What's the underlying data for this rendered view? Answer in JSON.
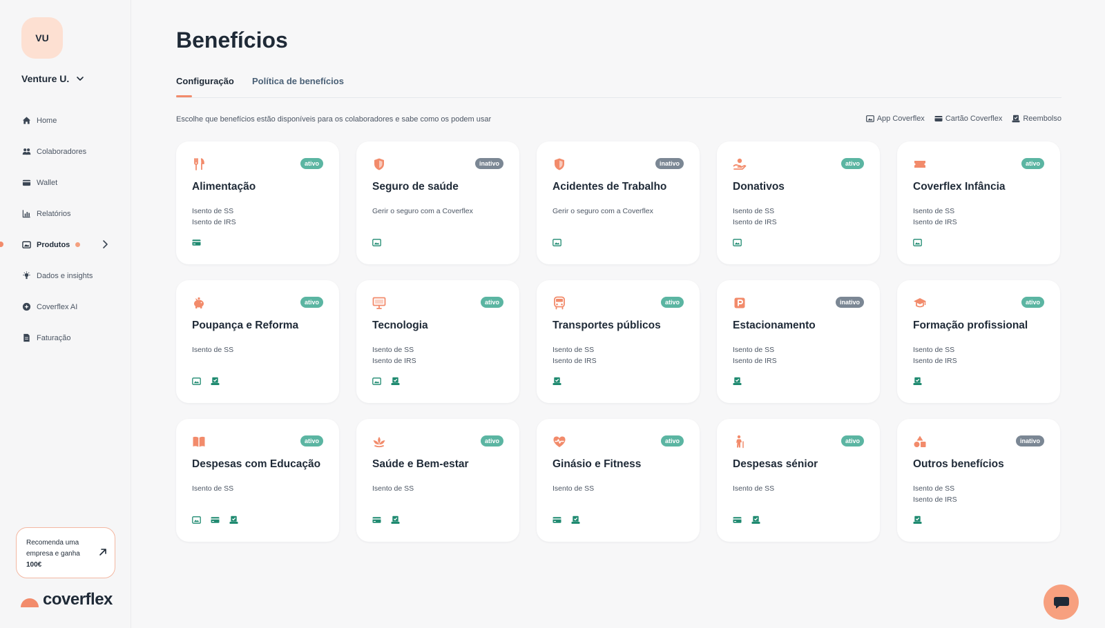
{
  "sidebar": {
    "avatar_initials": "VU",
    "company_name": "Venture U.",
    "items": [
      {
        "label": "Home",
        "icon": "home-icon"
      },
      {
        "label": "Colaboradores",
        "icon": "users-icon"
      },
      {
        "label": "Wallet",
        "icon": "wallet-icon"
      },
      {
        "label": "Relatórios",
        "icon": "chart-icon"
      },
      {
        "label": "Produtos",
        "icon": "products-icon",
        "active": true
      },
      {
        "label": "Dados e insights",
        "icon": "insights-icon"
      },
      {
        "label": "Coverflex AI",
        "icon": "ai-icon"
      },
      {
        "label": "Faturação",
        "icon": "invoice-icon"
      }
    ],
    "promo": {
      "line1": "Recomenda uma",
      "line2": "empresa e ganha",
      "amount": "100€"
    },
    "logo_text": "coverflex"
  },
  "header": {
    "title": "Benefícios",
    "tabs": [
      "Configuração",
      "Política de benefícios"
    ]
  },
  "intro": {
    "description": "Escolhe que benefícios estão disponíveis para os colaboradores e sabe como os podem usar",
    "legend": [
      "App Coverflex",
      "Cartão Coverflex",
      "Reembolso"
    ]
  },
  "cards": [
    {
      "title": "Alimentação",
      "badge": "ativo",
      "icon": "fork-knife-icon",
      "lines": [
        "Isento de SS",
        "Isento de IRS"
      ],
      "channels": [
        "card"
      ]
    },
    {
      "title": "Seguro de saúde",
      "badge": "inativo",
      "icon": "shield-icon",
      "lines": [
        "Gerir o seguro com a Coverflex"
      ],
      "channels": [
        "app"
      ]
    },
    {
      "title": "Acidentes de Trabalho",
      "badge": "inativo",
      "icon": "shield-icon",
      "lines": [
        "Gerir o seguro com a Coverflex"
      ],
      "channels": [
        "app"
      ]
    },
    {
      "title": "Donativos",
      "badge": "ativo",
      "icon": "donation-icon",
      "lines": [
        "Isento de SS",
        "Isento de IRS"
      ],
      "channels": [
        "app"
      ]
    },
    {
      "title": "Coverflex Infância",
      "badge": "ativo",
      "icon": "ticket-icon",
      "lines": [
        "Isento de SS",
        "Isento de IRS"
      ],
      "channels": [
        "app"
      ]
    },
    {
      "title": "Poupança e Reforma",
      "badge": "ativo",
      "icon": "piggy-bank-icon",
      "lines": [
        "Isento de SS"
      ],
      "channels": [
        "app",
        "refund"
      ]
    },
    {
      "title": "Tecnologia",
      "badge": "ativo",
      "icon": "monitor-icon",
      "lines": [
        "Isento de SS",
        "Isento de IRS"
      ],
      "channels": [
        "app",
        "refund"
      ]
    },
    {
      "title": "Transportes públicos",
      "badge": "ativo",
      "icon": "bus-icon",
      "lines": [
        "Isento de SS",
        "Isento de IRS"
      ],
      "channels": [
        "refund"
      ]
    },
    {
      "title": "Estacionamento",
      "badge": "inativo",
      "icon": "parking-icon",
      "lines": [
        "Isento de SS",
        "Isento de IRS"
      ],
      "channels": [
        "refund"
      ]
    },
    {
      "title": "Formação profissional",
      "badge": "ativo",
      "icon": "graduation-cap-icon",
      "lines": [
        "Isento de SS",
        "Isento de IRS"
      ],
      "channels": [
        "refund"
      ]
    },
    {
      "title": "Despesas com Educação",
      "badge": "ativo",
      "icon": "book-icon",
      "lines": [
        "Isento de SS"
      ],
      "channels": [
        "app",
        "card",
        "refund"
      ]
    },
    {
      "title": "Saúde e Bem-estar",
      "badge": "ativo",
      "icon": "lotus-icon",
      "lines": [
        "Isento de SS"
      ],
      "channels": [
        "card",
        "refund"
      ]
    },
    {
      "title": "Ginásio e Fitness",
      "badge": "ativo",
      "icon": "heart-pulse-icon",
      "lines": [
        "Isento de SS"
      ],
      "channels": [
        "card",
        "refund"
      ]
    },
    {
      "title": "Despesas sénior",
      "badge": "ativo",
      "icon": "elderly-icon",
      "lines": [
        "Isento de SS"
      ],
      "channels": [
        "card",
        "refund"
      ]
    },
    {
      "title": "Outros benefícios",
      "badge": "inativo",
      "icon": "shapes-icon",
      "lines": [
        "Isento de SS",
        "Isento de IRS"
      ],
      "channels": [
        "refund"
      ]
    }
  ],
  "colors": {
    "accent": "#f28b6b",
    "active_badge": "#5bb5a2",
    "inactive_badge": "#7b8794",
    "channel_icon": "#1f8a70"
  }
}
